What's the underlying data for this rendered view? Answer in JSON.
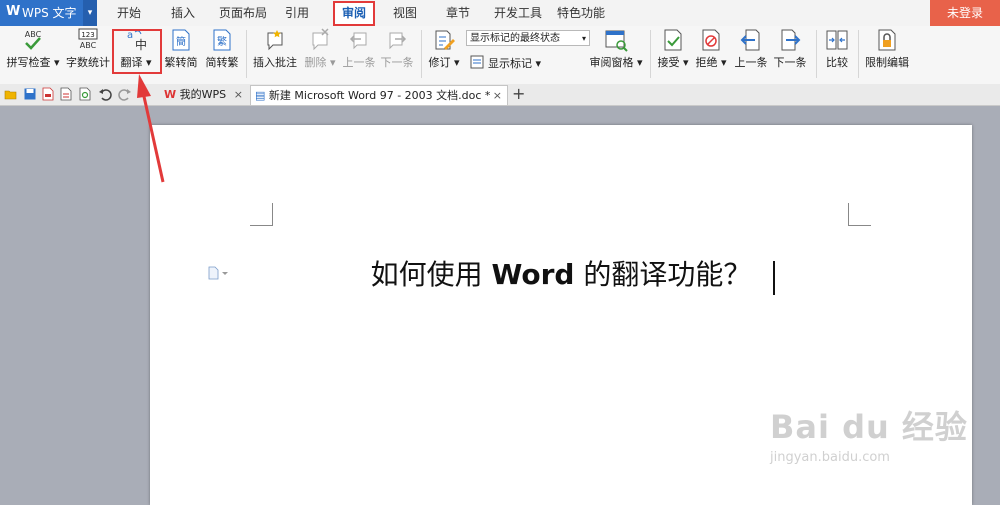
{
  "app": {
    "title": "WPS 文字",
    "logo": "W"
  },
  "menu": {
    "tabs": [
      {
        "label": "开始"
      },
      {
        "label": "插入"
      },
      {
        "label": "页面布局"
      },
      {
        "label": "引用"
      },
      {
        "label": "审阅"
      },
      {
        "label": "视图"
      },
      {
        "label": "章节"
      },
      {
        "label": "开发工具"
      },
      {
        "label": "特色功能"
      }
    ],
    "active_tab": "审阅",
    "login": "未登录"
  },
  "ribbon": {
    "spellcheck": {
      "label": "拼写检查",
      "icon_text": "ABC"
    },
    "wordcount": {
      "label": "字数统计",
      "icon_text_top": "123",
      "icon_text_bottom": "ABC"
    },
    "translate": {
      "label": "翻译",
      "icon_text": "a中"
    },
    "trad_to_simp": {
      "label": "繁转简",
      "icon_text": "簡"
    },
    "simp_to_trad": {
      "label": "简转繁",
      "icon_text": "繁"
    },
    "insert_comment": {
      "label": "插入批注"
    },
    "delete": {
      "label": "删除"
    },
    "prev_item": {
      "label": "上一条"
    },
    "next_item": {
      "label": "下一条"
    },
    "track_changes": {
      "label": "修订"
    },
    "markup_state": {
      "value": "显示标记的最终状态"
    },
    "show_markup": {
      "label": "显示标记"
    },
    "review_pane": {
      "label": "审阅窗格"
    },
    "accept": {
      "label": "接受"
    },
    "reject": {
      "label": "拒绝"
    },
    "prev_change": {
      "label": "上一条"
    },
    "next_change": {
      "label": "下一条"
    },
    "compare": {
      "label": "比较"
    },
    "restrict_edit": {
      "label": "限制编辑"
    }
  },
  "doctabs": {
    "mywps": "我的WPS",
    "doc": "新建 Microsoft Word 97 - 2003 文档.doc *",
    "close": "×",
    "add": "+"
  },
  "document": {
    "title_part1": "如何使用 ",
    "title_word": "Word",
    "title_part2": " 的翻译功能？"
  },
  "watermark": {
    "line1": "Bai du 经验",
    "line2": "jingyan.baidu.com"
  },
  "colors": {
    "accent": "#2f72c9",
    "highlight": "#e23a3a",
    "login": "#e8624a"
  }
}
